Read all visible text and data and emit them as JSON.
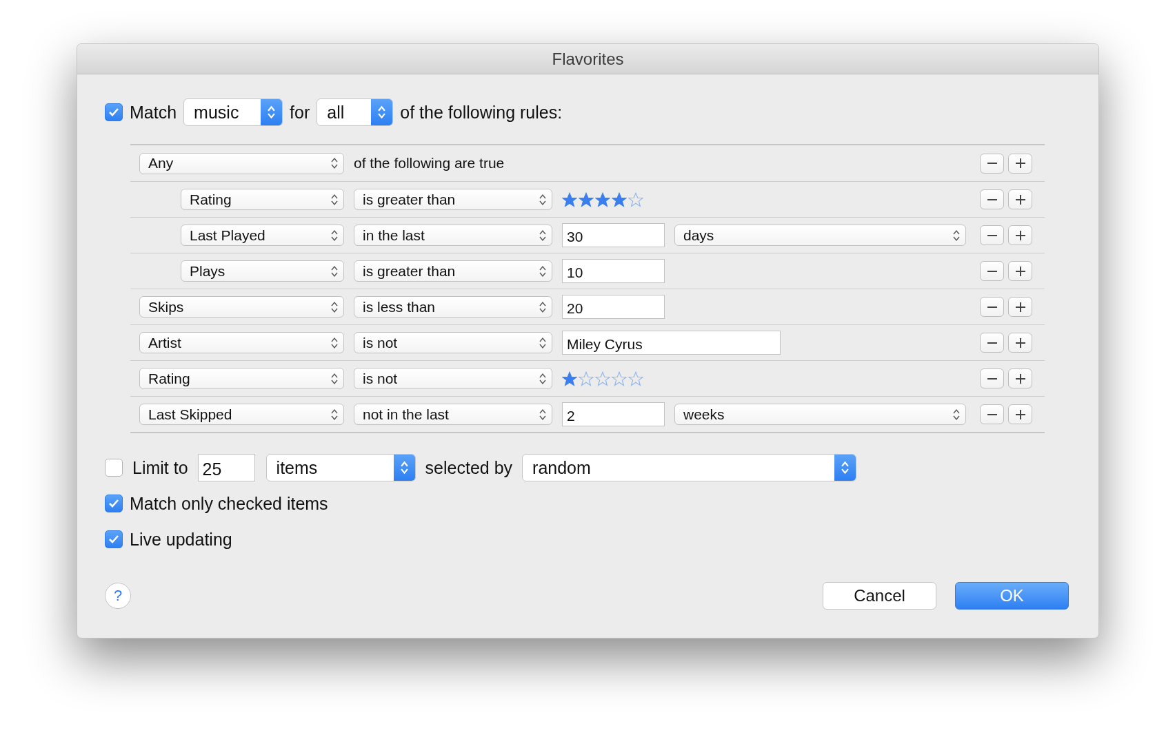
{
  "window": {
    "title": "Flavorites"
  },
  "match": {
    "checked": true,
    "label": "Match",
    "media": "music",
    "for_label": "for",
    "quantifier": "all",
    "suffix": "of the following rules:"
  },
  "rules": [
    {
      "kind": "group",
      "field": "Any",
      "text": "of the following are true",
      "children": [
        {
          "kind": "stars",
          "field": "Rating",
          "operator": "is greater than",
          "stars": 4
        },
        {
          "kind": "number_unit",
          "field": "Last Played",
          "operator": "in the last",
          "value": "30",
          "unit": "days"
        },
        {
          "kind": "number",
          "field": "Plays",
          "operator": "is greater than",
          "value": "10"
        }
      ]
    },
    {
      "kind": "number",
      "field": "Skips",
      "operator": "is less than",
      "value": "20"
    },
    {
      "kind": "text",
      "field": "Artist",
      "operator": "is not",
      "value": "Miley Cyrus"
    },
    {
      "kind": "stars",
      "field": "Rating",
      "operator": "is not",
      "stars": 1
    },
    {
      "kind": "number_unit",
      "field": "Last Skipped",
      "operator": "not in the last",
      "value": "2",
      "unit": "weeks"
    }
  ],
  "limit": {
    "checked": false,
    "label": "Limit to",
    "value": "25",
    "unit": "items",
    "selected_by": "selected by",
    "method": "random"
  },
  "options": [
    {
      "label": "Match only checked items",
      "checked": true
    },
    {
      "label": "Live updating",
      "checked": true
    }
  ],
  "help": "?",
  "buttons": [
    {
      "label": "Cancel",
      "kind": "normal"
    },
    {
      "label": "OK",
      "kind": "default"
    }
  ]
}
